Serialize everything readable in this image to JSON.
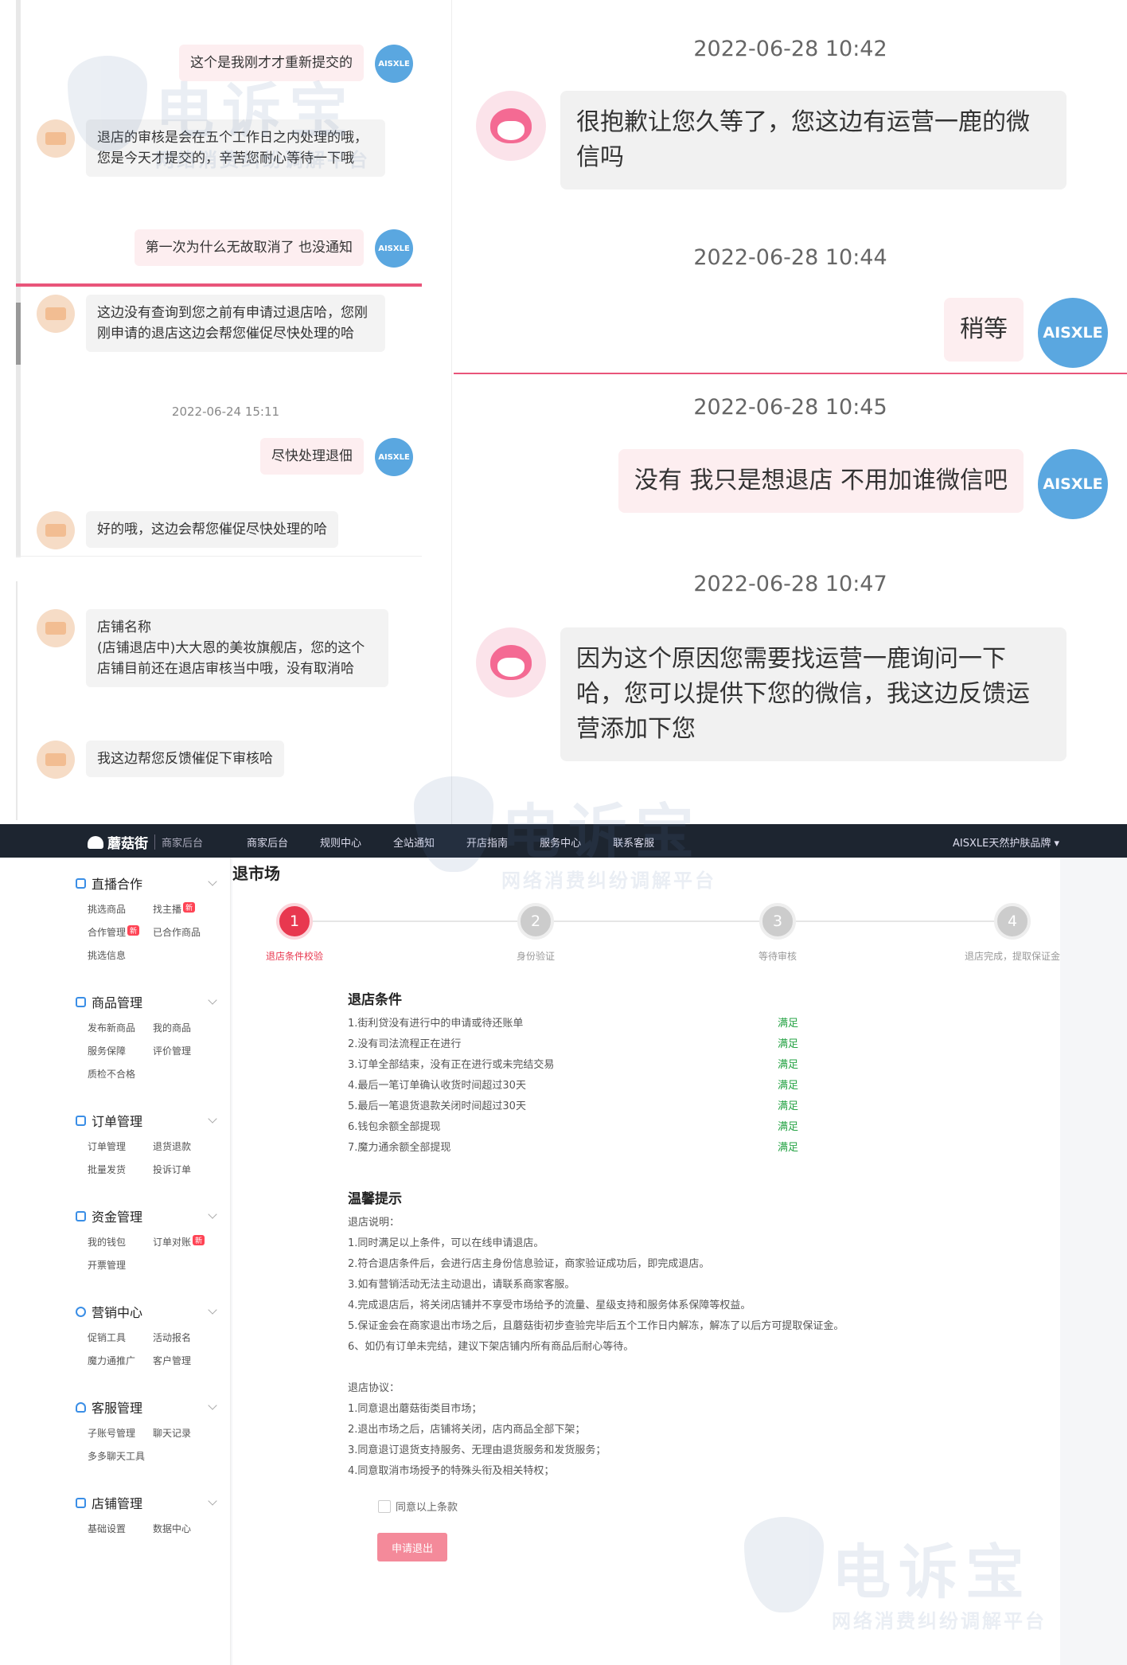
{
  "left_chat": {
    "messages": [
      {
        "text": "这个是我刚才才重新提交的"
      },
      {
        "text": "退店的审核是会在五个工作日之内处理的哦，您是今天才提交的，辛苦您耐心等待一下哦"
      },
      {
        "text": "第一次为什么无故取消了 也没通知"
      },
      {
        "text": "这边没有查询到您之前有申请过退店哈，您刚刚申请的退店这边会帮您催促尽快处理的哈"
      },
      {
        "text": "尽快处理退佃"
      },
      {
        "text": "好的哦，这边会帮您催促尽快处理的哈"
      },
      {
        "text": "店铺名称\n(店铺退店中)大大恩的美妆旗舰店，您的这个店铺目前还在退店审核当中哦，没有取消哈"
      },
      {
        "text": "我这边帮您反馈催促下审核哈"
      }
    ],
    "timestamp": "2022-06-24 15:11",
    "avatar_label": "AISXLE"
  },
  "right_chat": {
    "items": [
      {
        "timestamp": "2022-06-28 10:42",
        "text": "很抱歉让您久等了，您这边有运营一鹿的微信吗"
      },
      {
        "timestamp": "2022-06-28 10:44",
        "text": "稍等"
      },
      {
        "timestamp": "2022-06-28 10:45",
        "text": "没有  我只是想退店  不用加谁微信吧"
      },
      {
        "timestamp": "2022-06-28 10:47",
        "text": "因为这个原因您需要找运营一鹿询问一下哈，您可以提供下您的微信，我这边反馈运营添加下您"
      }
    ],
    "avatar_label": "AISXLE"
  },
  "watermark": {
    "title": "电诉宝",
    "subtitle": "网络消费纠纷调解平台"
  },
  "topbar": {
    "brand": "蘑菇街",
    "brand_sub": "商家后台",
    "nav": [
      "商家后台",
      "规则中心",
      "全站通知",
      "开店指南",
      "服务中心",
      "联系客服"
    ],
    "user": "AISXLE天然护肤品牌 ▾"
  },
  "sidebar": {
    "groups": [
      {
        "title": "直播合作",
        "items": [
          "挑选商品",
          "找主播",
          "合作管理",
          "已合作商品",
          "挑选信息"
        ]
      },
      {
        "title": "商品管理",
        "items": [
          "发布新商品",
          "我的商品",
          "服务保障",
          "评价管理",
          "质检不合格"
        ]
      },
      {
        "title": "订单管理",
        "items": [
          "订单管理",
          "退货退款",
          "批量发货",
          "投诉订单"
        ]
      },
      {
        "title": "资金管理",
        "items": [
          "我的钱包",
          "订单对账",
          "开票管理"
        ]
      },
      {
        "title": "营销中心",
        "items": [
          "促销工具",
          "活动报名",
          "魔力通推广",
          "客户管理"
        ]
      },
      {
        "title": "客服管理",
        "items": [
          "子账号管理",
          "聊天记录",
          "多多聊天工具"
        ]
      },
      {
        "title": "店铺管理",
        "items": [
          "基础设置",
          "数据中心"
        ]
      }
    ],
    "new_badge": "新"
  },
  "main": {
    "title": "退市场",
    "steps": [
      {
        "num": "1",
        "label": "退店条件校验"
      },
      {
        "num": "2",
        "label": "身份验证"
      },
      {
        "num": "3",
        "label": "等待审核"
      },
      {
        "num": "4",
        "label": "退店完成，提取保证金"
      }
    ],
    "conditions_title": "退店条件",
    "conditions": [
      {
        "text": "1.街利贷没有进行中的申请或待还账单",
        "status": "满足"
      },
      {
        "text": "2.没有司法流程正在进行",
        "status": "满足"
      },
      {
        "text": "3.订单全部结束，没有正在进行或未完结交易",
        "status": "满足"
      },
      {
        "text": "4.最后一笔订单确认收货时间超过30天",
        "status": "满足"
      },
      {
        "text": "5.最后一笔退货退款关闭时间超过30天",
        "status": "满足"
      },
      {
        "text": "6.钱包余额全部提现",
        "status": "满足"
      },
      {
        "text": "7.魔力通余额全部提现",
        "status": "满足"
      }
    ],
    "tips_title": "温馨提示",
    "tips_heading": "退店说明：",
    "tips": [
      "1.同时满足以上条件，可以在线申请退店。",
      "2.符合退店条件后，会进行店主身份信息验证，商家验证成功后，即完成退店。",
      "3.如有营销活动无法主动退出，请联系商家客服。",
      "4.完成退店后，将关闭店铺并不享受市场给予的流量、星级支持和服务体系保障等权益。",
      "5.保证金会在商家退出市场之后，且蘑菇街初步查验完毕后五个工作日内解冻，解冻了以后方可提取保证金。",
      "6、如仍有订单未完结，建议下架店铺内所有商品后耐心等待。"
    ],
    "agreement_heading": "退店协议：",
    "agreement": [
      "1.同意退出蘑菇街类目市场；",
      "2.退出市场之后，店铺将关闭，店内商品全部下架；",
      "3.同意退订退货支持服务、无理由退货服务和发货服务；",
      "4.同意取消市场授予的特殊头衔及相关特权；"
    ],
    "agree_label": "同意以上条款",
    "apply_button": "申请退出"
  }
}
